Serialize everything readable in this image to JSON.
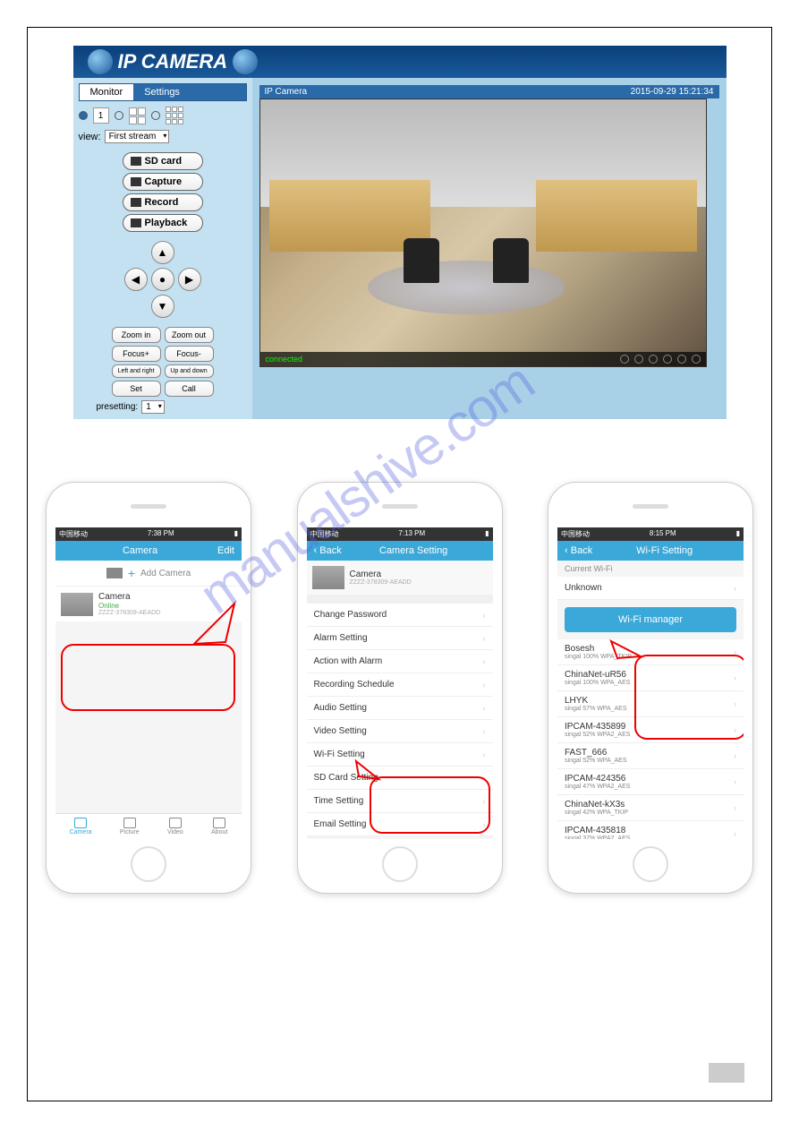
{
  "ipcam": {
    "title": "IP CAMERA",
    "tabs": {
      "monitor": "Monitor",
      "settings": "Settings"
    },
    "grid_number": "1",
    "view_label": "view:",
    "stream_select": "First stream",
    "buttons": {
      "sdcard": "SD card",
      "capture": "Capture",
      "record": "Record",
      "playback": "Playback"
    },
    "controls": {
      "zoom_in": "Zoom in",
      "zoom_out": "Zoom out",
      "focus_plus": "Focus+",
      "focus_minus": "Focus-",
      "leftright": "Left and right",
      "updown": "Up and down",
      "set": "Set",
      "call": "Call"
    },
    "preset_label": "presetting:",
    "preset_value": "1",
    "video": {
      "title": "IP Camera",
      "timestamp": "2015-09-29 15:21:34",
      "status": "connected"
    }
  },
  "watermark": "manualshive.com",
  "phone1": {
    "status": {
      "carrier": "中国移动",
      "time": "7:38 PM",
      "batt": "▮"
    },
    "nav_title": "Camera",
    "nav_right": "Edit",
    "add_label": "Add Camera",
    "camera": {
      "name": "Camera",
      "status": "Online",
      "id": "ZZZZ-378309-AEADD"
    },
    "tabs": {
      "camera": "Camera",
      "picture": "Picture",
      "video": "Video",
      "about": "About"
    }
  },
  "phone2": {
    "status": {
      "carrier": "中国移动",
      "time": "7:13 PM",
      "batt": "▮"
    },
    "back": "Back",
    "nav_title": "Camera Setting",
    "camera": {
      "name": "Camera",
      "id": "ZZZZ-378309-AEADD"
    },
    "items": [
      "Change Password",
      "Alarm Setting",
      "Action with Alarm",
      "Recording Schedule",
      "Audio Setting",
      "Video Setting",
      "Wi-Fi Setting",
      "SD Card Setting",
      "Time Setting",
      "Email Setting"
    ]
  },
  "phone3": {
    "status": {
      "carrier": "中国移动",
      "time": "8:15 PM",
      "batt": "▮"
    },
    "back": "Back",
    "nav_title": "Wi-Fi Setting",
    "current_label": "Current Wi-Fi",
    "current_value": "Unknown",
    "manager_btn": "Wi-Fi manager",
    "networks": [
      {
        "name": "Bosesh",
        "signal": "singal 100%",
        "sec": "WPA_TKIP"
      },
      {
        "name": "ChinaNet-uR56",
        "signal": "singal 100%",
        "sec": "WPA_AES"
      },
      {
        "name": "LHYK",
        "signal": "singal 57%",
        "sec": "WPA_AES"
      },
      {
        "name": "IPCAM-435899",
        "signal": "singal 52%",
        "sec": "WPA2_AES"
      },
      {
        "name": "FAST_666",
        "signal": "singal 52%",
        "sec": "WPA_AES"
      },
      {
        "name": "IPCAM-424356",
        "signal": "singal 47%",
        "sec": "WPA2_AES"
      },
      {
        "name": "ChinaNet-kX3s",
        "signal": "singal 42%",
        "sec": "WPA_TKIP"
      },
      {
        "name": "IPCAM-435818",
        "signal": "singal 37%",
        "sec": "WPA2_AES"
      }
    ]
  }
}
